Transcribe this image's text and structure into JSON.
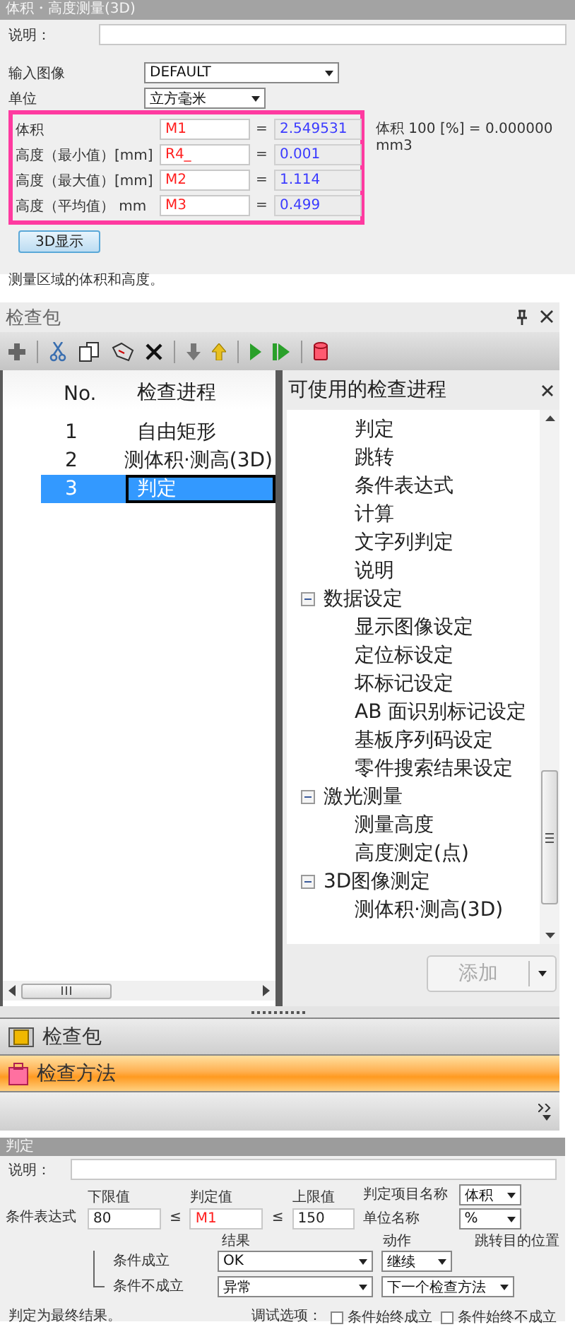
{
  "measure_panel": {
    "title": "体积・高度测量(3D)",
    "description_label": "说明：",
    "input_image": {
      "label": "输入图像",
      "value": "DEFAULT"
    },
    "unit": {
      "label": "单位",
      "value": "立方毫米"
    },
    "measurements": [
      {
        "label": "体积",
        "expression": "M1",
        "equals": "=",
        "result": "2.549531"
      },
      {
        "label": "高度（最小值）[mm]",
        "expression": "R4_",
        "equals": "=",
        "result": "0.001"
      },
      {
        "label": "高度（最大值）[mm]",
        "expression": "M2",
        "equals": "=",
        "result": "1.114"
      },
      {
        "label": "高度（平均值） mm",
        "expression": "M3",
        "equals": "=",
        "result": "0.499"
      }
    ],
    "volume_note": "体积 100 [%] =  0.000000 mm3",
    "button": "3D显示",
    "footer": "测量区域的体积和高度。"
  },
  "package_panel": {
    "title": "检查包",
    "columns": [
      "No.",
      "检查进程"
    ],
    "rows": [
      {
        "no": "1",
        "name": "自由矩形",
        "selected": false
      },
      {
        "no": "2",
        "name": "测体积·测高(3D)",
        "selected": false
      },
      {
        "no": "3",
        "name": "判定",
        "selected": true
      }
    ],
    "available": {
      "title": "可使用的检查进程",
      "continued_items": [
        "判定",
        "跳转",
        "条件表达式",
        "计算",
        "文字列判定",
        "说明"
      ],
      "groups": [
        {
          "label": "数据设定",
          "expanded": true,
          "children": [
            "显示图像设定",
            "定位标设定",
            "坏标记设定",
            "AB 面识别标记设定",
            "基板序列码设定",
            "零件搜索结果设定"
          ]
        },
        {
          "label": "激光测量",
          "expanded": true,
          "children": [
            "测量高度",
            "高度测定(点)"
          ]
        },
        {
          "label": "3D图像测定",
          "expanded": true,
          "children": [
            "测体积·测高(3D)"
          ]
        }
      ],
      "add_button": {
        "label": "添加",
        "disabled": true
      }
    },
    "nav_tabs": [
      {
        "label": "检查包",
        "selected": false
      },
      {
        "label": "检查方法",
        "selected": true
      }
    ]
  },
  "judge_panel": {
    "title": "判定",
    "description_label": "说明：",
    "expression_label": "条件表达式",
    "lower": {
      "label": "下限值",
      "value": "80"
    },
    "op1": "≤",
    "judge": {
      "label": "判定值",
      "value": "M1"
    },
    "op2": "≤",
    "upper": {
      "label": "上限值",
      "value": "150"
    },
    "item_name": {
      "label": "判定项目名称",
      "value": "体积"
    },
    "unit_name": {
      "label": "单位名称",
      "value": "%"
    },
    "result_header": "结果",
    "action_header": "动作",
    "jump_header": "跳转目的位置",
    "outcomes": [
      {
        "label": "条件成立",
        "result": "OK",
        "action": "继续"
      },
      {
        "label": "条件不成立",
        "result": "异常",
        "action": "下一个检查方法"
      }
    ],
    "footer": "判定为最终结果。",
    "debug_label": "调试选项：",
    "debug_options": [
      {
        "label": "条件始终成立",
        "checked": false
      },
      {
        "label": "条件始终不成立",
        "checked": false
      }
    ]
  }
}
